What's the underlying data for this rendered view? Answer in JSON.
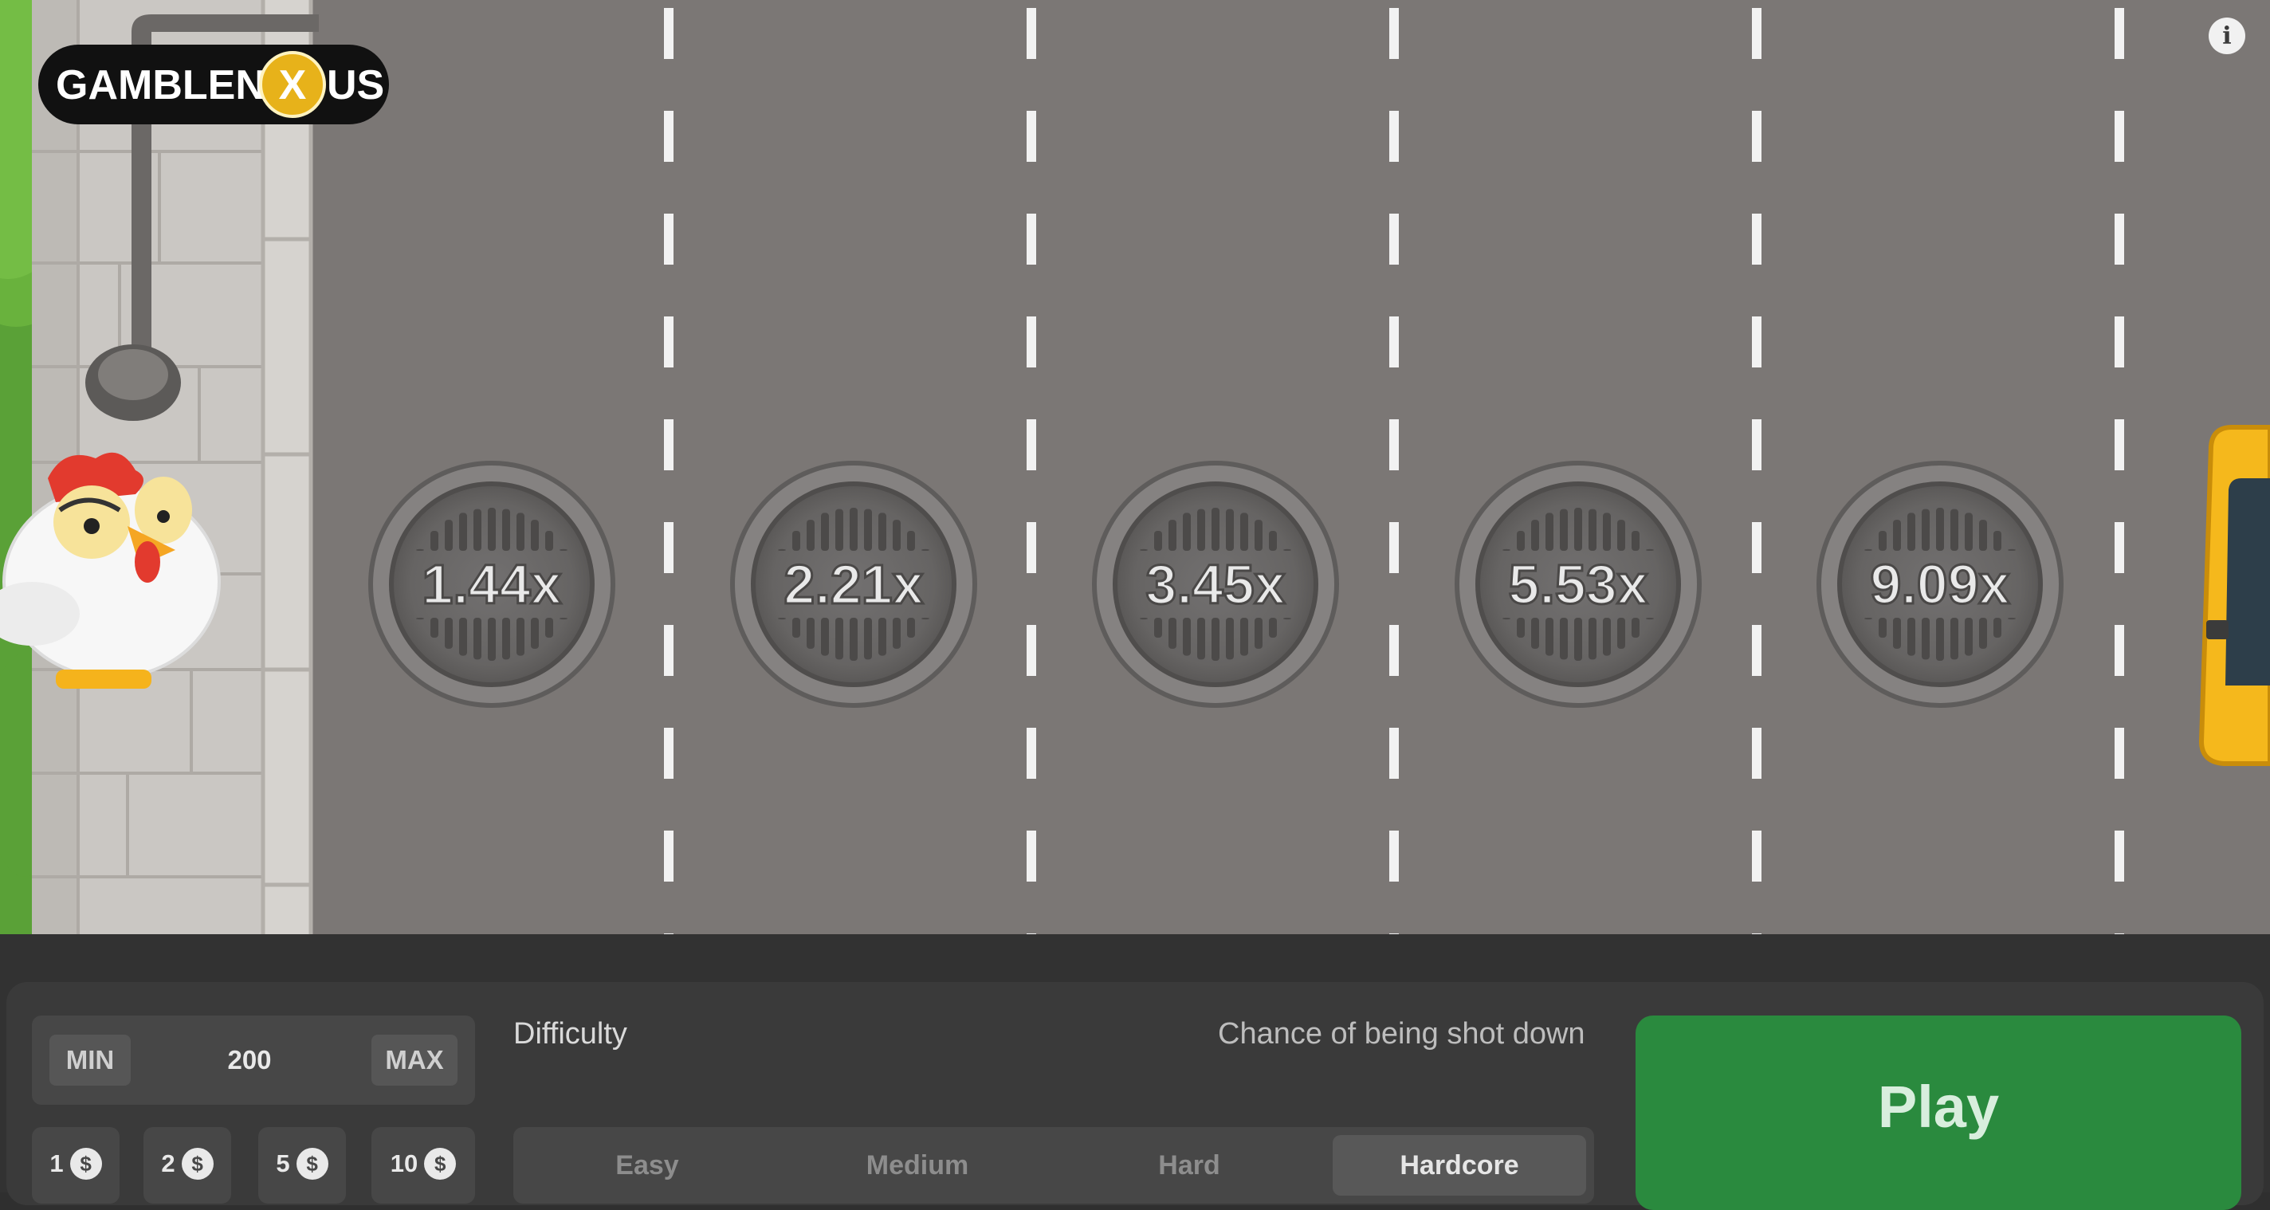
{
  "brand": {
    "logo_text_left": "GAMBLENE",
    "logo_text_mid": "X",
    "logo_text_right": "US"
  },
  "colors": {
    "road": "#7b7775",
    "sidewalk": "#c9c6c2",
    "grass": "#5aa137",
    "lane_marking": "#f2f2f2",
    "manhole": "#6d6b6a",
    "panel": "#3a3a3a",
    "play_button": "#2a8a3e",
    "taxi": "#f5b81c"
  },
  "multipliers": [
    "1.44x",
    "2.21x",
    "3.45x",
    "5.53x",
    "9.09x"
  ],
  "bet": {
    "min_label": "MIN",
    "value": "200",
    "max_label": "MAX"
  },
  "quick_bets": [
    {
      "amount": "1",
      "currency_symbol": "$"
    },
    {
      "amount": "2",
      "currency_symbol": "$"
    },
    {
      "amount": "5",
      "currency_symbol": "$"
    },
    {
      "amount": "10",
      "currency_symbol": "$"
    }
  ],
  "difficulty": {
    "label": "Difficulty",
    "chance_label": "Chance of being shot down",
    "options": [
      "Easy",
      "Medium",
      "Hard",
      "Hardcore"
    ],
    "selected": "Hardcore"
  },
  "play_label": "Play",
  "icons": {
    "info": "info-icon",
    "character": "chicken",
    "vehicle": "taxi"
  }
}
